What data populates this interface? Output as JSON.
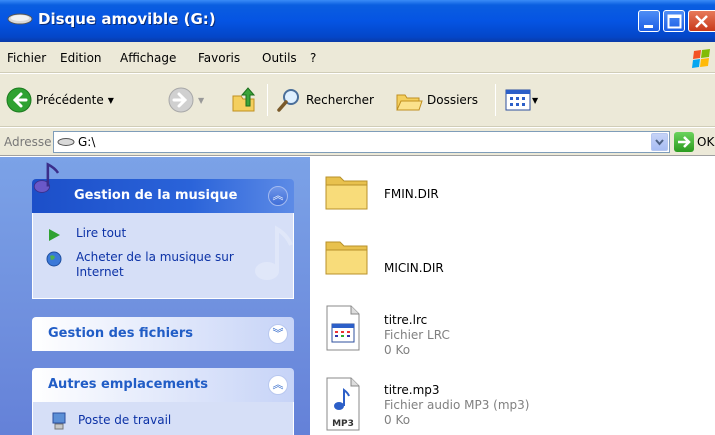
{
  "window": {
    "title": "Disque amovible (G:)"
  },
  "menu": {
    "items": [
      "Fichier",
      "Edition",
      "Affichage",
      "Favoris",
      "Outils",
      "?"
    ]
  },
  "toolbar": {
    "back_label": "Précédente",
    "search_label": "Rechercher",
    "folders_label": "Dossiers"
  },
  "address": {
    "label": "Adresse",
    "value": "G:\\",
    "go_label": "OK"
  },
  "taskpane": {
    "music": {
      "title": "Gestion de la musique",
      "links": [
        "Lire tout",
        "Acheter de la musique sur",
        "Internet"
      ]
    },
    "files": {
      "title": "Gestion des fichiers"
    },
    "other": {
      "title": "Autres emplacements",
      "links": [
        "Poste de travail"
      ]
    }
  },
  "files": [
    {
      "name": "FMIN.DIR",
      "type": "",
      "size": "",
      "icon": "folder-icon"
    },
    {
      "name": "MICIN.DIR",
      "type": "",
      "size": "",
      "icon": "folder-icon"
    },
    {
      "name": "titre.lrc",
      "type": "Fichier LRC",
      "size": "0 Ko",
      "icon": "lrc-file-icon"
    },
    {
      "name": "titre.mp3",
      "type": "Fichier audio MP3 (mp3)",
      "size": "0 Ko",
      "icon": "mp3-file-icon"
    }
  ],
  "icons": {
    "mp3_badge": "MP3"
  },
  "colors": {
    "titlebar": "#0554e3",
    "taskpane": "#7ba2e7",
    "link": "#0c32a6"
  }
}
